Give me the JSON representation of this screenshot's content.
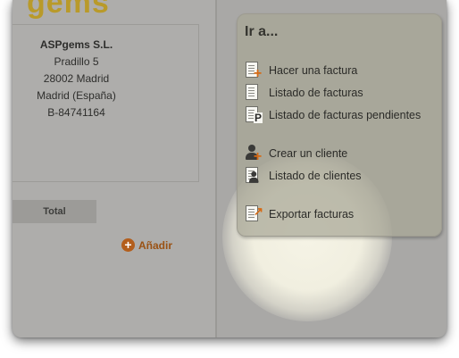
{
  "left": {
    "logo_text": "gems",
    "logo_accent": "#b99a2a",
    "company": {
      "name": "ASPgems S.L.",
      "street": "Pradillo 5",
      "city": "28002 Madrid",
      "region": "Madrid (España)",
      "tax_id": "B-84741164"
    },
    "total_label": "Total",
    "add_label": "Añadir",
    "add_icon": "plus-circle-icon"
  },
  "goto": {
    "title": "Ir a...",
    "items": [
      {
        "label": "Hacer una factura",
        "icon": "invoice-add-icon"
      },
      {
        "label": "Listado de facturas",
        "icon": "invoice-list-icon"
      },
      {
        "label": "Listado de facturas pendientes",
        "icon": "invoice-pending-icon"
      },
      {
        "label": "Crear un cliente",
        "icon": "client-add-icon"
      },
      {
        "label": "Listado de clientes",
        "icon": "client-list-icon"
      },
      {
        "label": "Exportar facturas",
        "icon": "export-invoices-icon"
      }
    ]
  },
  "colors": {
    "accent_orange": "#d66a14",
    "link_brown": "#9a5214"
  }
}
